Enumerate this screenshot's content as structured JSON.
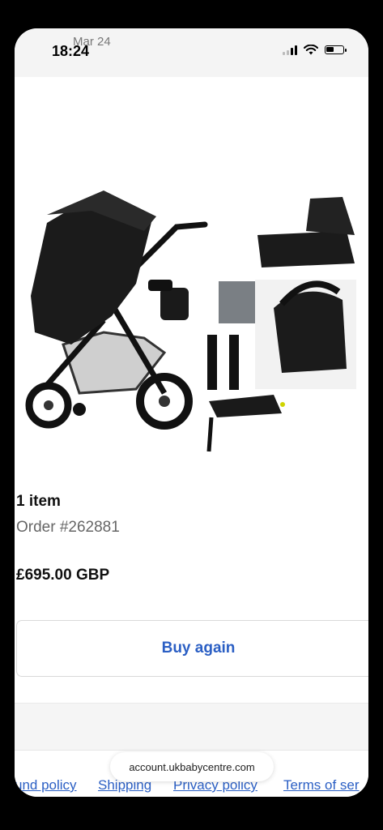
{
  "status_bar": {
    "time": "18:24",
    "date_overlay": "Mar 24"
  },
  "product": {
    "image_icon": "stroller-travel-system-image"
  },
  "order": {
    "item_count": "1 item",
    "order_number": "Order #262881",
    "price": "£695.00 GBP"
  },
  "actions": {
    "buy_again_label": "Buy again"
  },
  "browser": {
    "url": "account.ukbabycentre.com"
  },
  "footer": {
    "links": [
      "und policy",
      "Shipping",
      "Privacy policy",
      "Terms of ser"
    ]
  },
  "colors": {
    "link": "#2b5fc4",
    "text": "#111111",
    "muted": "#666666"
  }
}
